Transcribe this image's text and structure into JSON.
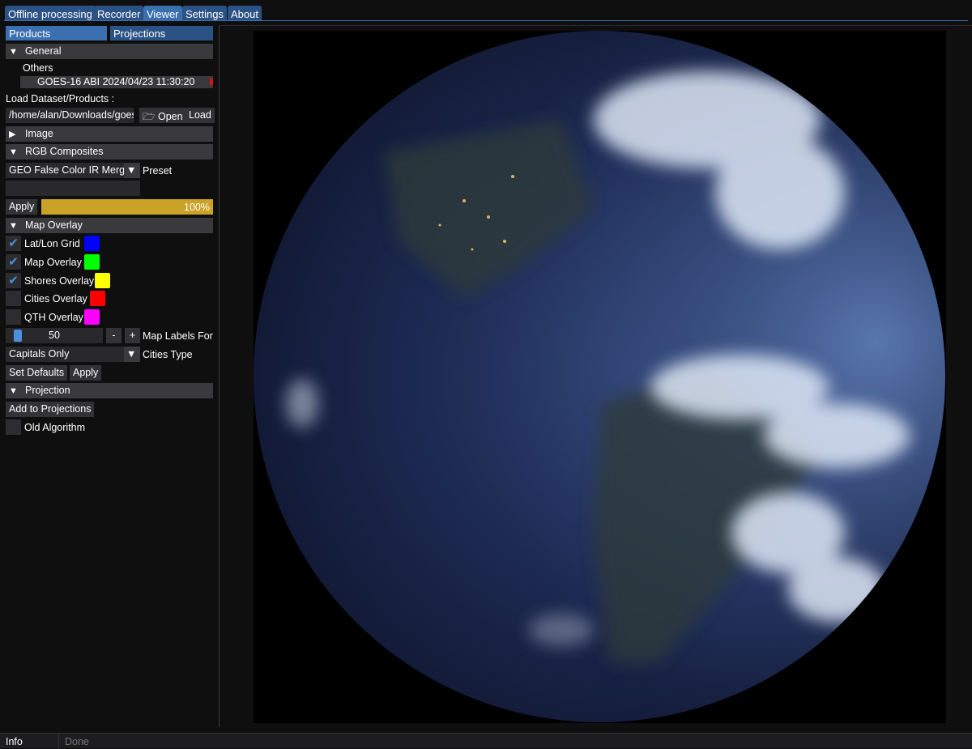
{
  "main_tabs": [
    {
      "label": "Offline processing"
    },
    {
      "label": "Recorder"
    },
    {
      "label": "Viewer",
      "active": true
    },
    {
      "label": "Settings"
    },
    {
      "label": "About"
    }
  ],
  "sub_tabs": [
    {
      "label": "Products",
      "active": true
    },
    {
      "label": "Projections"
    }
  ],
  "general": {
    "title": "General",
    "group": "Others",
    "product": "GOES-16 ABI 2024/04/23 11:30:20"
  },
  "load": {
    "label": "Load Dataset/Products :",
    "path": "/home/alan/Downloads/goes",
    "open": "Open",
    "load": "Load"
  },
  "image": {
    "title": "Image"
  },
  "rgb": {
    "title": "RGB Composites",
    "preset_value": "GEO False Color IR Merge",
    "preset_label": "Preset",
    "apply": "Apply",
    "progress_text": "100%",
    "progress": 100,
    "progress_color": "#c9a227"
  },
  "overlay": {
    "title": "Map Overlay",
    "items": [
      {
        "label": "Lat/Lon Grid",
        "checked": true,
        "color": "#0000ff"
      },
      {
        "label": "Map Overlay",
        "checked": true,
        "color": "#00ff00"
      },
      {
        "label": "Shores Overlay",
        "checked": true,
        "color": "#ffff00"
      },
      {
        "label": "Cities Overlay",
        "checked": false,
        "color": "#ff0000"
      },
      {
        "label": "QTH Overlay",
        "checked": false,
        "color": "#ff00ff"
      }
    ],
    "font_value": "50",
    "minus": "-",
    "plus": "+",
    "font_label": "Map Labels Font",
    "cities_value": "Capitals Only",
    "cities_label": "Cities Type",
    "set_defaults": "Set Defaults",
    "apply": "Apply"
  },
  "projection": {
    "title": "Projection",
    "add": "Add to Projections",
    "old_algorithm": "Old Algorithm",
    "old_checked": false
  },
  "status": {
    "label": "Info",
    "text": "Done"
  },
  "check_glyph": "✔"
}
